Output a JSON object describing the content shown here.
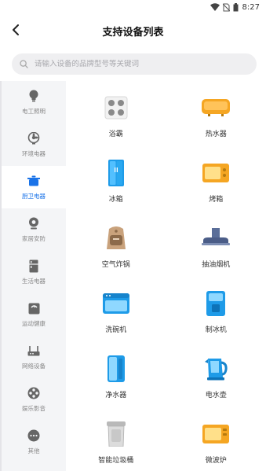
{
  "status": {
    "time": "8:27"
  },
  "header": {
    "title": "支持设备列表"
  },
  "search": {
    "placeholder": "请输入设备的品牌型号等关键词"
  },
  "sidebar": {
    "items": [
      {
        "label": "电工照明",
        "icon": "lightbulb-icon",
        "active": false
      },
      {
        "label": "环境电器",
        "icon": "fan-icon",
        "active": false
      },
      {
        "label": "厨卫电器",
        "icon": "pot-icon",
        "active": true
      },
      {
        "label": "家居安防",
        "icon": "camera-icon",
        "active": false
      },
      {
        "label": "生活电器",
        "icon": "fridge-icon",
        "active": false
      },
      {
        "label": "运动健康",
        "icon": "scale-icon",
        "active": false
      },
      {
        "label": "网络设备",
        "icon": "router-icon",
        "active": false
      },
      {
        "label": "娱乐影音",
        "icon": "film-reel-icon",
        "active": false
      },
      {
        "label": "其他",
        "icon": "more-icon",
        "active": false
      }
    ]
  },
  "devices": [
    {
      "label": "浴霸",
      "icon": "bath-heater-icon"
    },
    {
      "label": "热水器",
      "icon": "water-heater-icon"
    },
    {
      "label": "冰箱",
      "icon": "refrigerator-icon"
    },
    {
      "label": "烤箱",
      "icon": "oven-icon"
    },
    {
      "label": "空气炸锅",
      "icon": "air-fryer-icon"
    },
    {
      "label": "抽油烟机",
      "icon": "range-hood-icon"
    },
    {
      "label": "洗碗机",
      "icon": "dishwasher-icon"
    },
    {
      "label": "制冰机",
      "icon": "ice-maker-icon"
    },
    {
      "label": "净水器",
      "icon": "water-purifier-icon"
    },
    {
      "label": "电水壶",
      "icon": "electric-kettle-icon"
    },
    {
      "label": "智能垃圾桶",
      "icon": "smart-trash-can-icon"
    },
    {
      "label": "微波炉",
      "icon": "microwave-icon"
    }
  ],
  "colors": {
    "accent": "#1a73e8",
    "sidebar_bg": "#f4f5f7",
    "search_bg": "#efeff1"
  }
}
